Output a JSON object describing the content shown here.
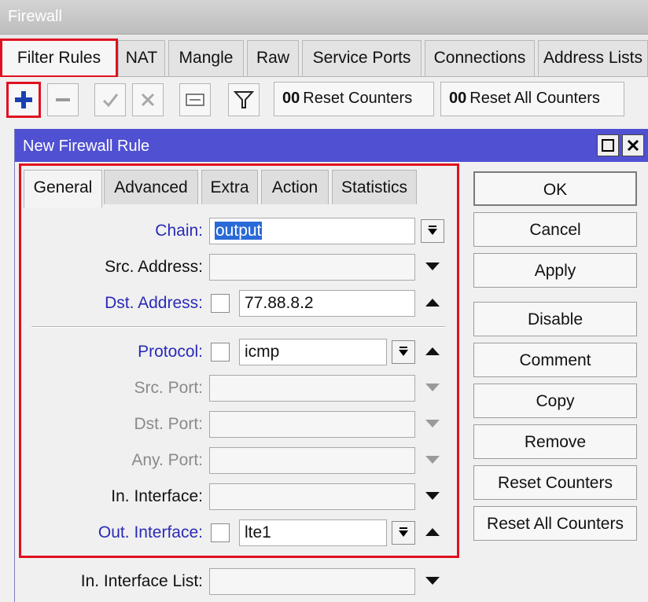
{
  "window": {
    "title": "Firewall"
  },
  "tabs": [
    {
      "label": "Filter Rules"
    },
    {
      "label": "NAT"
    },
    {
      "label": "Mangle"
    },
    {
      "label": "Raw"
    },
    {
      "label": "Service Ports"
    },
    {
      "label": "Connections"
    },
    {
      "label": "Address Lists"
    }
  ],
  "toolbar": {
    "reset_counters": "Reset Counters",
    "reset_all_counters": "Reset All Counters",
    "counter_glyph": "00"
  },
  "dialog": {
    "title": "New Firewall Rule",
    "tabs": [
      {
        "label": "General"
      },
      {
        "label": "Advanced"
      },
      {
        "label": "Extra"
      },
      {
        "label": "Action"
      },
      {
        "label": "Statistics"
      }
    ],
    "fields": {
      "chain": {
        "label": "Chain:",
        "value": "output"
      },
      "src_address": {
        "label": "Src. Address:",
        "value": ""
      },
      "dst_address": {
        "label": "Dst. Address:",
        "value": "77.88.8.2"
      },
      "protocol": {
        "label": "Protocol:",
        "value": "icmp"
      },
      "src_port": {
        "label": "Src. Port:",
        "value": ""
      },
      "dst_port": {
        "label": "Dst. Port:",
        "value": ""
      },
      "any_port": {
        "label": "Any. Port:",
        "value": ""
      },
      "in_interface": {
        "label": "In. Interface:",
        "value": ""
      },
      "out_interface": {
        "label": "Out. Interface:",
        "value": "lte1"
      },
      "in_interface_list": {
        "label": "In. Interface List:",
        "value": ""
      }
    },
    "buttons": {
      "ok": "OK",
      "cancel": "Cancel",
      "apply": "Apply",
      "disable": "Disable",
      "comment": "Comment",
      "copy": "Copy",
      "remove": "Remove",
      "reset_counters": "Reset Counters",
      "reset_all_counters": "Reset All Counters"
    }
  },
  "colors": {
    "highlight_outline": "#e01020",
    "dialog_title_bar": "#5050d2",
    "required_label": "#2a2ab8",
    "add_icon": "#1a3fb0"
  },
  "icons": [
    "add-icon",
    "remove-icon",
    "enable-icon",
    "disable-icon",
    "comment-icon",
    "filter-icon",
    "restore-icon",
    "close-icon"
  ]
}
